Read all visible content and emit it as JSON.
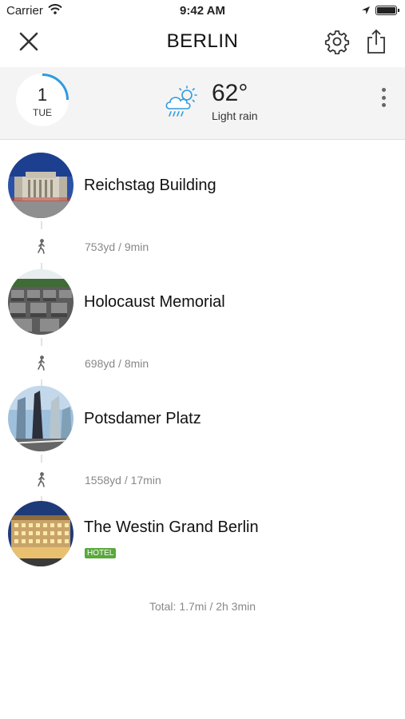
{
  "status_bar": {
    "carrier": "Carrier",
    "time": "9:42 AM"
  },
  "header": {
    "title": "BERLIN"
  },
  "weather": {
    "day_number": "1",
    "day_name": "TUE",
    "temperature": "62°",
    "condition": "Light rain"
  },
  "stops": [
    {
      "name": "Reichstag Building",
      "badge": ""
    },
    {
      "name": "Holocaust Memorial",
      "badge": ""
    },
    {
      "name": "Potsdamer Platz",
      "badge": ""
    },
    {
      "name": "The Westin Grand Berlin",
      "badge": "HOTEL"
    }
  ],
  "segments": [
    {
      "distance": "753yd / 9min"
    },
    {
      "distance": "698yd / 8min"
    },
    {
      "distance": "1558yd / 17min"
    }
  ],
  "total": "Total: 1.7mi / 2h 3min",
  "colors": {
    "accent_blue": "#2e9be0",
    "hotel_badge": "#5aa83c"
  }
}
